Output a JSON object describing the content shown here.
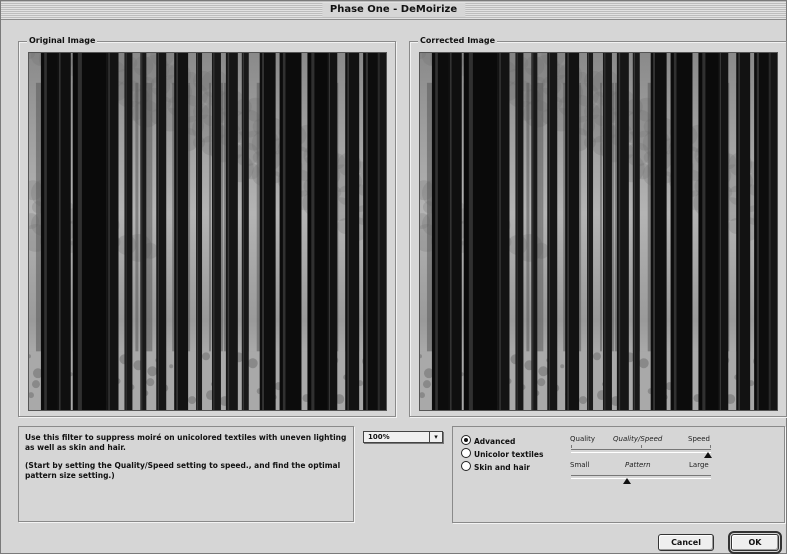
{
  "window": {
    "title": "Phase One - DeMoirize"
  },
  "original": {
    "label": "Original Image",
    "image_icon": "forest-photo"
  },
  "corrected": {
    "label": "Corrected Image",
    "image_icon": "forest-photo"
  },
  "description": {
    "line1": "Use this filter to suppress moiré on unicolored textiles with uneven lighting as well as skin and hair.",
    "line2": "(Start by setting the Quality/Speed setting to speed., and find the optimal pattern size setting.)"
  },
  "zoom": {
    "value": "100%",
    "arrow_icon": "chevron-down-icon"
  },
  "modes": {
    "items": [
      {
        "label": "Advanced",
        "selected": true
      },
      {
        "label": "Unicolor textiles",
        "selected": false
      },
      {
        "label": "Skin and hair",
        "selected": false
      }
    ]
  },
  "quality_slider": {
    "left": "Quality",
    "center": "Quality/Speed",
    "right": "Speed",
    "value_fraction": 0.98
  },
  "pattern_slider": {
    "left": "Small",
    "center": "Pattern",
    "right": "Large",
    "value_fraction": 0.4
  },
  "buttons": {
    "cancel": "Cancel",
    "ok": "OK"
  }
}
